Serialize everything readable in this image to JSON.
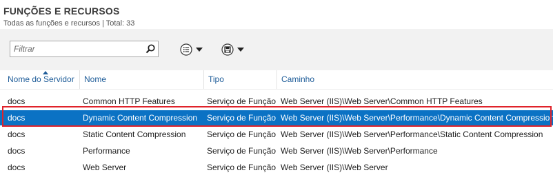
{
  "header": {
    "title": "FUNÇÕES E RECURSOS",
    "subtitle": "Todas as funções e recursos | Total: 33"
  },
  "toolbar": {
    "filter_placeholder": "Filtrar",
    "icons": [
      "search-icon",
      "list-options-icon",
      "save-icon"
    ]
  },
  "table": {
    "columns": [
      "Nome do Servidor",
      "Nome",
      "Tipo",
      "Caminho"
    ],
    "sorted_column": "Nome do Servidor",
    "rows": [
      {
        "server": "docs",
        "name": "Common HTTP Features",
        "type": "Serviço de Função",
        "path": "Web Server (IIS)\\Web Server\\Common HTTP Features"
      },
      {
        "server": "docs",
        "name": "Dynamic Content Compression",
        "type": "Serviço de Função",
        "path": "Web Server (IIS)\\Web Server\\Performance\\Dynamic Content Compression",
        "selected": true
      },
      {
        "server": "docs",
        "name": "Static Content Compression",
        "type": "Serviço de Função",
        "path": "Web Server (IIS)\\Web Server\\Performance\\Static Content Compression"
      },
      {
        "server": "docs",
        "name": "Performance",
        "type": "Serviço de Função",
        "path": "Web Server (IIS)\\Web Server\\Performance"
      },
      {
        "server": "docs",
        "name": "Web Server",
        "type": "Serviço de Função",
        "path": "Web Server (IIS)\\Web Server"
      }
    ]
  },
  "colors": {
    "selection": "#0b72c4",
    "highlight_outline": "#e0222a",
    "header_text": "#1f5d99"
  }
}
